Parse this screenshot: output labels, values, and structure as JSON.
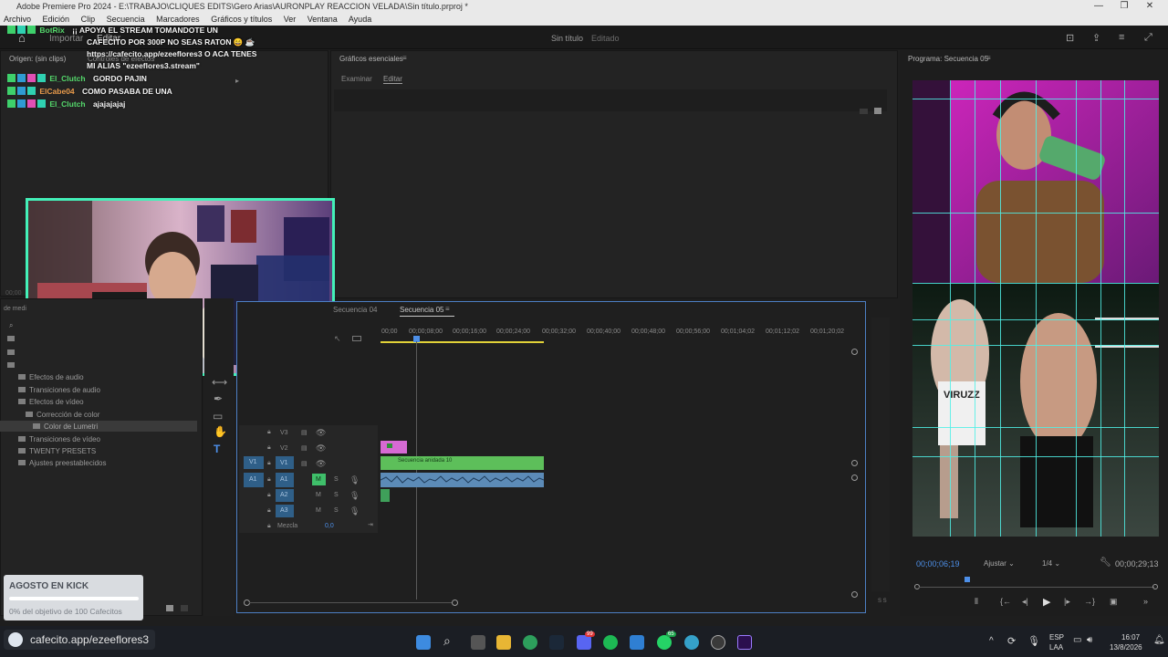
{
  "window": {
    "title": "Adobe Premiere Pro 2024 - E:\\TRABAJO\\CLIQUES EDITS\\Gero Arias\\AURONPLAY REACCION VELADA\\Sin título.prproj *",
    "controls": [
      "—",
      "❐",
      "✕"
    ]
  },
  "menu": [
    "Archivo",
    "Edición",
    "Clip",
    "Secuencia",
    "Marcadores",
    "Gráficos y títulos",
    "Ver",
    "Ventana",
    "Ayuda"
  ],
  "header": {
    "home_icon": "home-icon",
    "tabs": [
      "Importar",
      "Editar"
    ],
    "project_title": "Sin título",
    "project_status": "Editado"
  },
  "source_panel": {
    "title": "Origen: (sin clips)",
    "tab2": "Controles de efectos",
    "timecode": "00;00"
  },
  "chat": [
    {
      "user": "BotRix",
      "message": "¡¡ APOYA EL STREAM TOMANDOTE UN",
      "color": "green"
    },
    {
      "user": "",
      "message": "CAFECITO POR 300P NO SEAS RATON 😄 ☕",
      "color": "green"
    },
    {
      "user": "",
      "message": "https://cafecito.app/ezeeflores3 O ACA TENES",
      "color": "green"
    },
    {
      "user": "",
      "message": "MI ALIAS \"ezeeflores3.stream\"",
      "color": "green"
    },
    {
      "user": "El_Clutch",
      "message": "GORDO PAJIN",
      "color": "green"
    },
    {
      "user": "ElCabe04",
      "message": "COMO PASABA DE UNA",
      "color": "orange"
    },
    {
      "user": "El_Clutch",
      "message": "ajajajajaj",
      "color": "green"
    }
  ],
  "graphics_panel": {
    "title": "Gráficos esenciales",
    "tabs": [
      "Examinar",
      "Editar"
    ]
  },
  "project_panel": {
    "label_left": "de medi",
    "items": [
      "Efectos de audio",
      "Transiciones de audio",
      "Efectos de vídeo",
      "Corrección de color",
      "Color de Lumetri",
      "Transiciones de vídeo",
      "TWENTY PRESETS",
      "Ajustes preestablecidos"
    ]
  },
  "timeline": {
    "tabs": [
      "Secuencia 04",
      "Secuencia 05"
    ],
    "ruler": [
      "00;00",
      "00;00;08;00",
      "00;00;16;00",
      "00;00;24;00",
      "00;00;32;00",
      "00;00;40;00",
      "00;00;48;00",
      "00;00;56;00",
      "00;01;04;02",
      "00;01;12;02",
      "00;01;20;02"
    ],
    "tracks": [
      {
        "name": "V3"
      },
      {
        "name": "V2"
      },
      {
        "name": "V1",
        "source": "V1"
      },
      {
        "name": "A1",
        "source": "A1",
        "m": "M",
        "s": "S"
      },
      {
        "name": "A2",
        "m": "M",
        "s": "S"
      },
      {
        "name": "A3",
        "m": "M",
        "s": "S"
      }
    ],
    "mix_label": "Mezcla",
    "mix_value": "0,0",
    "nested_clip": "Secuencia anidada 10",
    "colors": {
      "video": "#5dbf5a",
      "graphic": "#d66ad3",
      "audio": "#5c8bb7",
      "playhead": "#4d8fe8"
    }
  },
  "program": {
    "title": "Programa: Secuencia 05",
    "timecode": "00;00;06;19",
    "fit": "Ajustar",
    "resolution": "1/4",
    "duration": "00;00;29;13",
    "shirt_text": "VIRUZZ"
  },
  "goal": {
    "title": "AGOSTO EN KICK",
    "progress_text": "0% del objetivo de 100 Cafecitos",
    "progress": 0.0
  },
  "donation_url": "cafecito.app/ezeeflores3",
  "taskbar": {
    "lang": "ESP",
    "region": "LAA",
    "time": "16:07",
    "date": "13/8/2026",
    "badges": [
      "99",
      "65"
    ]
  }
}
